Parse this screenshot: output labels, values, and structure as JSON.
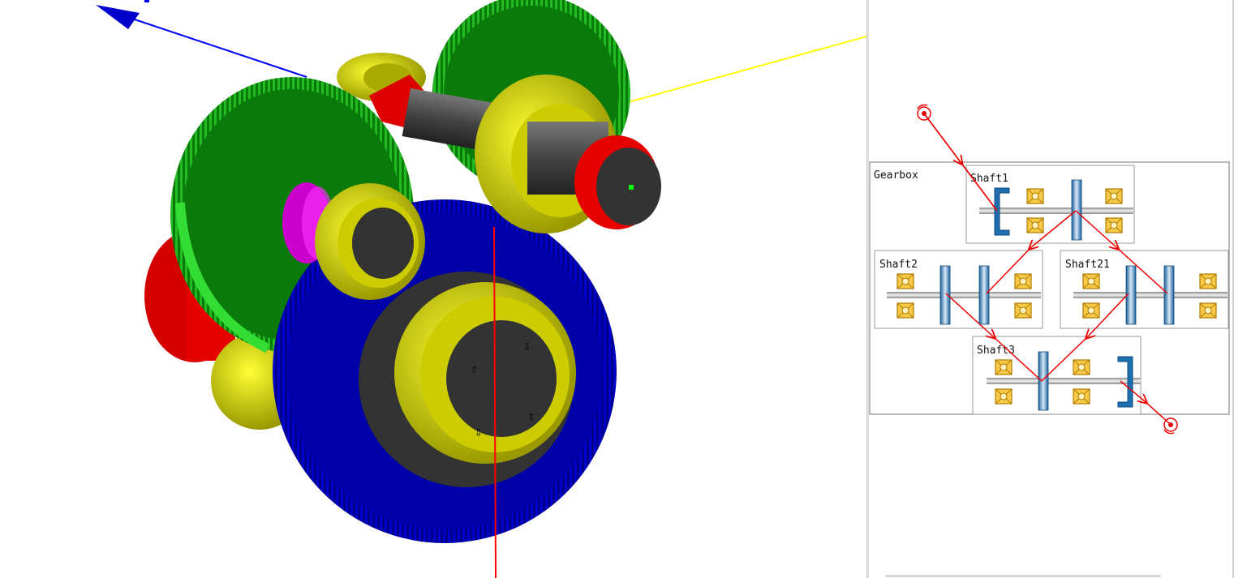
{
  "viewer3d": {
    "title": "",
    "colors": {
      "gear_large_front": "#0000aa",
      "gear_left": "#0a7a0a",
      "gear_top": "#0a7a0a",
      "gear_edge": "#33cc33",
      "bearing": "#d8d800",
      "shaft": "#444444",
      "pinion": "#cc00cc",
      "red_part": "#e60000",
      "axis_x": "#0000ff",
      "axis_y": "#ffff00",
      "axis_z": "#ff0000"
    }
  },
  "schematic": {
    "gearbox_label": "Gearbox",
    "shafts": [
      {
        "id": "shaft1",
        "label": "Shaft1"
      },
      {
        "id": "shaft2",
        "label": "Shaft2"
      },
      {
        "id": "shaft21",
        "label": "Shaft21"
      },
      {
        "id": "shaft3",
        "label": "Shaft3"
      }
    ],
    "icons": {
      "input": "torque-input-icon",
      "output": "torque-output-icon",
      "bearing": "bearing-icon",
      "gear": "gear-icon",
      "coupling": "coupling-icon"
    },
    "colors": {
      "power_flow": "#ee0000",
      "gear": "#1f6fb0",
      "bearing": "#e6a000",
      "frame": "#888888"
    }
  }
}
